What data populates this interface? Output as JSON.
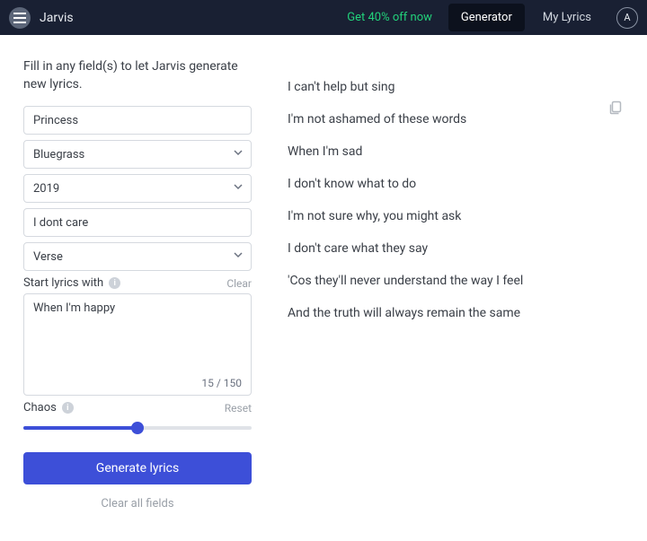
{
  "header": {
    "brand": "Jarvis",
    "promo": "Get 40% off now",
    "tabs": {
      "generator": "Generator",
      "mylyrics": "My Lyrics"
    },
    "avatar_initial": "A"
  },
  "form": {
    "instructions": "Fill in any field(s) to let Jarvis generate new lyrics.",
    "topic_value": "Princess",
    "genre_value": "Bluegrass",
    "year_value": "2019",
    "mood_value": "I dont care",
    "section_value": "Verse",
    "start_label": "Start lyrics with",
    "clear_label": "Clear",
    "start_value": "When I'm happy",
    "char_count": "15 / 150",
    "chaos_label": "Chaos",
    "reset_label": "Reset",
    "chaos_value": 50,
    "generate_label": "Generate lyrics",
    "clear_all_label": "Clear all fields"
  },
  "lyrics": {
    "lines": [
      "I can't help but sing",
      "I'm not ashamed of these words",
      "When I'm sad",
      "I don't know what to do",
      "I'm not sure why, you might ask",
      "I don't care what they say",
      "'Cos they'll never understand the way I feel",
      "And the truth will always remain the same"
    ]
  }
}
